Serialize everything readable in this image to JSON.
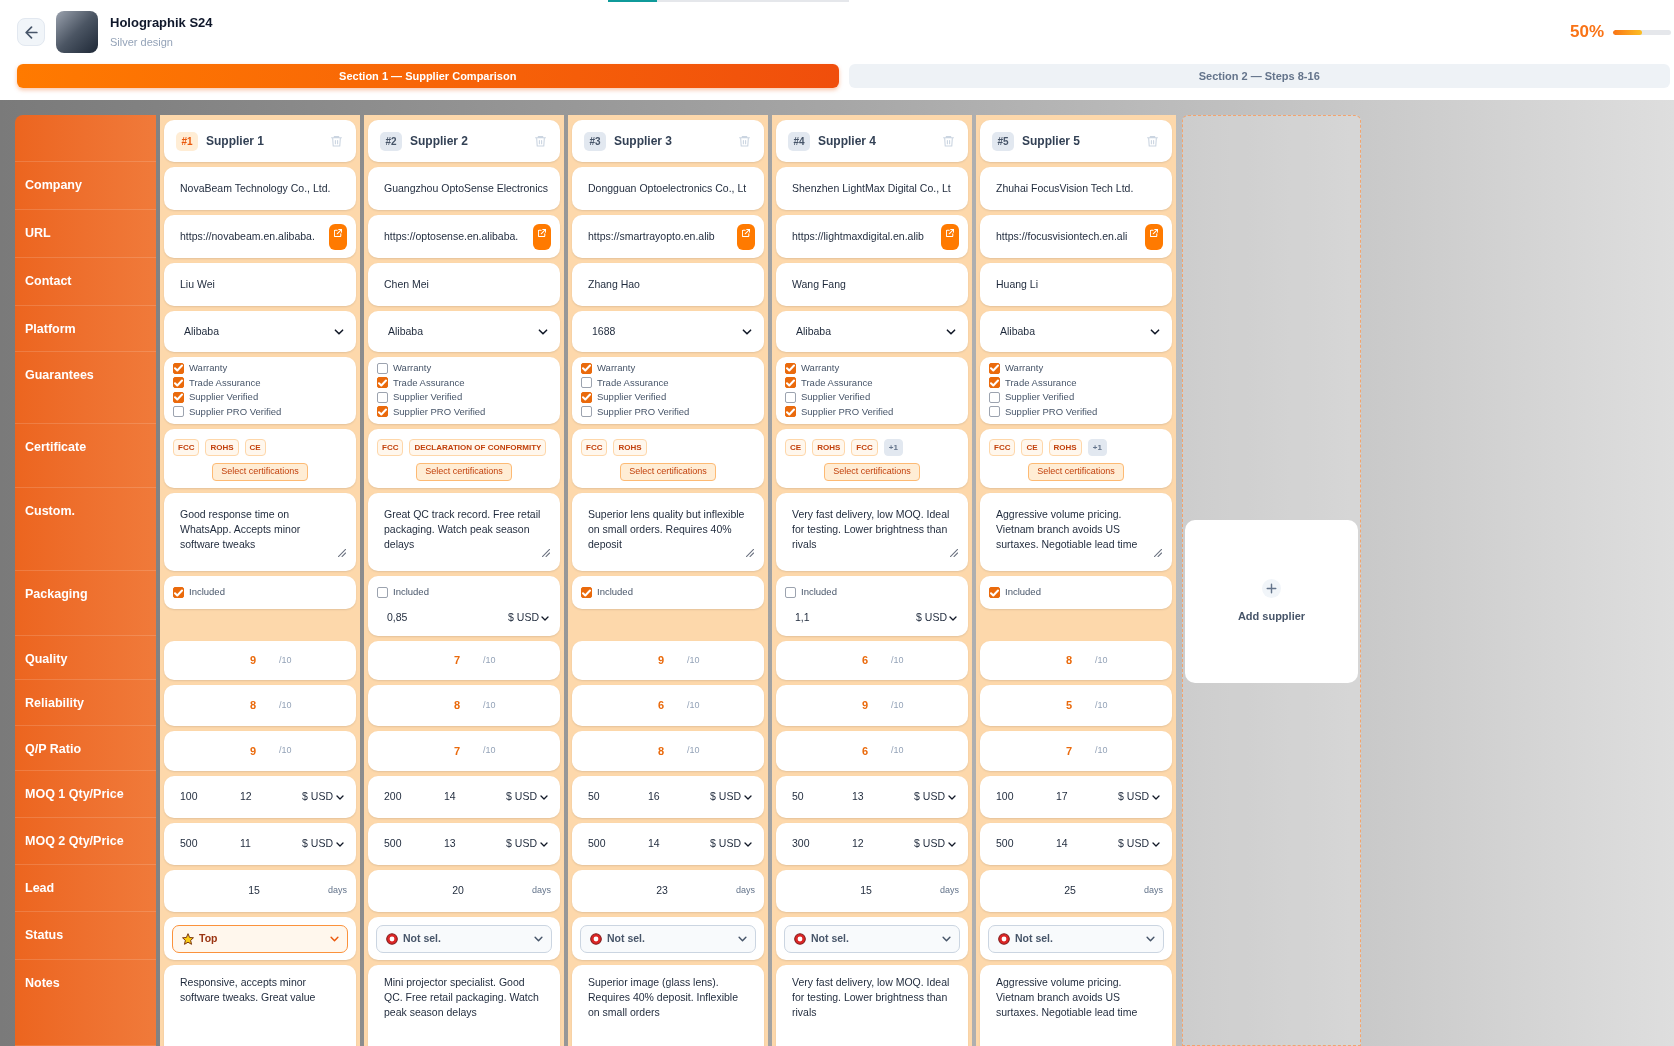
{
  "header": {
    "title": "Holographik S24",
    "subtitle": "Silver design",
    "progress": {
      "reading": "50%",
      "level": 0.5
    }
  },
  "section_tabs": [
    {
      "label": "Section 1 — Supplier Comparison",
      "selected": true
    },
    {
      "label": "Section 2 — Steps 8-16",
      "selected": false
    }
  ],
  "row_labels": [
    "Company",
    "URL",
    "Contact",
    "Platform",
    "Guarantees",
    "Certificate",
    "Custom.",
    "Packaging",
    "Quality",
    "Reliability",
    "Q/P Ratio",
    "MOQ 1 Qty/Price",
    "MOQ 2 Qty/Price",
    "Lead",
    "Status",
    "Notes"
  ],
  "suppliers": [
    {
      "number": "#1",
      "name": "Supplier 1",
      "company": "NovaBeam Technology Co., Ltd.",
      "url": "https://novabeam.en.alibaba.",
      "contact": "Liu Wei",
      "platform": "Alibaba",
      "guarantees": [
        {
          "label": "Warranty",
          "checked": true
        },
        {
          "label": "Trade Assurance",
          "checked": true
        },
        {
          "label": "Supplier Verified",
          "checked": true
        },
        {
          "label": "Supplier PRO Verified",
          "checked": false
        }
      ],
      "certificates": [
        {
          "kind": "tag",
          "label": "FCC"
        },
        {
          "kind": "tag",
          "label": "ROHS"
        },
        {
          "kind": "tag",
          "label": "CE"
        }
      ],
      "cert_button": "Select certifications",
      "custom": "Good response time on WhatsApp. Accepts minor software tweaks",
      "packaging": {
        "label": "Included",
        "included": true
      },
      "quality": {
        "value": "9",
        "scale": "/10"
      },
      "reliability": {
        "value": "8",
        "scale": "/10"
      },
      "qp_ratio": {
        "value": "9",
        "scale": "/10"
      },
      "moq": [
        {
          "qty": "100",
          "price": "12",
          "currency": "$ USD"
        },
        {
          "qty": "500",
          "price": "11",
          "currency": "$ USD"
        }
      ],
      "lead": {
        "value": "15",
        "unit": "days"
      },
      "status": {
        "kind": "top",
        "label": "Top"
      },
      "notes": "Responsive, accepts minor software tweaks. Great value"
    },
    {
      "number": "#2",
      "name": "Supplier 2",
      "company": "Guangzhou OptoSense Electronics",
      "url": "https://optosense.en.alibaba.",
      "contact": "Chen Mei",
      "platform": "Alibaba",
      "guarantees": [
        {
          "label": "Warranty",
          "checked": false
        },
        {
          "label": "Trade Assurance",
          "checked": true
        },
        {
          "label": "Supplier Verified",
          "checked": false
        },
        {
          "label": "Supplier PRO Verified",
          "checked": true
        }
      ],
      "certificates": [
        {
          "kind": "tag",
          "label": "FCC"
        },
        {
          "kind": "tag",
          "label": "DECLARATION OF CONFORMITY"
        }
      ],
      "cert_button": "Select certifications",
      "custom": "Great QC track record. Free retail packaging. Watch peak season delays",
      "packaging": {
        "label": "Included",
        "included": false,
        "price": "0,85",
        "currency": "$ USD"
      },
      "quality": {
        "value": "7",
        "scale": "/10"
      },
      "reliability": {
        "value": "8",
        "scale": "/10"
      },
      "qp_ratio": {
        "value": "7",
        "scale": "/10"
      },
      "moq": [
        {
          "qty": "200",
          "price": "14",
          "currency": "$ USD"
        },
        {
          "qty": "500",
          "price": "13",
          "currency": "$ USD"
        }
      ],
      "lead": {
        "value": "20",
        "unit": "days"
      },
      "status": {
        "kind": "not_selected",
        "label": "Not sel."
      },
      "notes": "Mini projector specialist. Good QC. Free retail packaging. Watch peak season delays"
    },
    {
      "number": "#3",
      "name": "Supplier 3",
      "company": "Dongguan Optoelectronics Co., Lt",
      "url": "https://smartrayopto.en.alib",
      "contact": "Zhang Hao",
      "platform": "1688",
      "guarantees": [
        {
          "label": "Warranty",
          "checked": true
        },
        {
          "label": "Trade Assurance",
          "checked": false
        },
        {
          "label": "Supplier Verified",
          "checked": true
        },
        {
          "label": "Supplier PRO Verified",
          "checked": false
        }
      ],
      "certificates": [
        {
          "kind": "tag",
          "label": "FCC"
        },
        {
          "kind": "tag",
          "label": "ROHS"
        }
      ],
      "cert_button": "Select certifications",
      "custom": "Superior lens quality but inflexible on small orders. Requires 40% deposit",
      "packaging": {
        "label": "Included",
        "included": true
      },
      "quality": {
        "value": "9",
        "scale": "/10"
      },
      "reliability": {
        "value": "6",
        "scale": "/10"
      },
      "qp_ratio": {
        "value": "8",
        "scale": "/10"
      },
      "moq": [
        {
          "qty": "50",
          "price": "16",
          "currency": "$ USD"
        },
        {
          "qty": "500",
          "price": "14",
          "currency": "$ USD"
        }
      ],
      "lead": {
        "value": "23",
        "unit": "days"
      },
      "status": {
        "kind": "not_selected",
        "label": "Not sel."
      },
      "notes": "Superior image (glass lens). Requires 40% deposit. Inflexible on small orders"
    },
    {
      "number": "#4",
      "name": "Supplier 4",
      "company": "Shenzhen LightMax Digital Co., Lt",
      "url": "https://lightmaxdigital.en.alib",
      "contact": "Wang Fang",
      "platform": "Alibaba",
      "guarantees": [
        {
          "label": "Warranty",
          "checked": true
        },
        {
          "label": "Trade Assurance",
          "checked": true
        },
        {
          "label": "Supplier Verified",
          "checked": false
        },
        {
          "label": "Supplier PRO Verified",
          "checked": true
        }
      ],
      "certificates": [
        {
          "kind": "tag",
          "label": "CE"
        },
        {
          "kind": "tag",
          "label": "ROHS"
        },
        {
          "kind": "tag",
          "label": "FCC"
        },
        {
          "kind": "more",
          "label": "+1"
        }
      ],
      "cert_button": "Select certifications",
      "custom": "Very fast delivery, low MOQ. Ideal for testing. Lower brightness than rivals",
      "packaging": {
        "label": "Included",
        "included": false,
        "price": "1,1",
        "currency": "$ USD"
      },
      "quality": {
        "value": "6",
        "scale": "/10"
      },
      "reliability": {
        "value": "9",
        "scale": "/10"
      },
      "qp_ratio": {
        "value": "6",
        "scale": "/10"
      },
      "moq": [
        {
          "qty": "50",
          "price": "13",
          "currency": "$ USD"
        },
        {
          "qty": "300",
          "price": "12",
          "currency": "$ USD"
        }
      ],
      "lead": {
        "value": "15",
        "unit": "days"
      },
      "status": {
        "kind": "not_selected",
        "label": "Not sel."
      },
      "notes": "Very fast delivery, low MOQ. Ideal for testing. Lower brightness than rivals"
    },
    {
      "number": "#5",
      "name": "Supplier 5",
      "company": "Zhuhai FocusVision Tech Ltd.",
      "url": "https://focusvisiontech.en.ali",
      "contact": "Huang Li",
      "platform": "Alibaba",
      "guarantees": [
        {
          "label": "Warranty",
          "checked": true
        },
        {
          "label": "Trade Assurance",
          "checked": true
        },
        {
          "label": "Supplier Verified",
          "checked": false
        },
        {
          "label": "Supplier PRO Verified",
          "checked": false
        }
      ],
      "certificates": [
        {
          "kind": "tag",
          "label": "FCC"
        },
        {
          "kind": "tag",
          "label": "CE"
        },
        {
          "kind": "tag",
          "label": "ROHS"
        },
        {
          "kind": "more",
          "label": "+1"
        }
      ],
      "cert_button": "Select certifications",
      "custom": "Aggressive volume pricing. Vietnam branch avoids US surtaxes. Negotiable lead time",
      "packaging": {
        "label": "Included",
        "included": true
      },
      "quality": {
        "value": "8",
        "scale": "/10"
      },
      "reliability": {
        "value": "5",
        "scale": "/10"
      },
      "qp_ratio": {
        "value": "7",
        "scale": "/10"
      },
      "moq": [
        {
          "qty": "100",
          "price": "17",
          "currency": "$ USD"
        },
        {
          "qty": "500",
          "price": "14",
          "currency": "$ USD"
        }
      ],
      "lead": {
        "value": "25",
        "unit": "days"
      },
      "status": {
        "kind": "not_selected",
        "label": "Not sel."
      },
      "notes": "Aggressive volume pricing. Vietnam branch avoids US surtaxes. Negotiable lead time"
    }
  ],
  "add_supplier": {
    "label": "Add supplier"
  }
}
